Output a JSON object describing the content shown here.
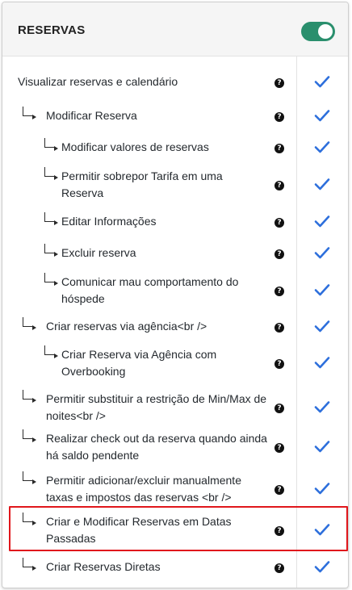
{
  "section": {
    "title": "RESERVAS",
    "toggle_on": true,
    "accent_color": "#2a8f6d",
    "check_color": "#2d6fdc",
    "highlight_color": "#e0161b"
  },
  "permissions": [
    {
      "label": "Visualizar reservas e calendário",
      "level": 0,
      "allowed": true
    },
    {
      "label": "Modificar Reserva",
      "level": 1,
      "allowed": true
    },
    {
      "label": "Modificar valores de reservas",
      "level": 2,
      "allowed": true
    },
    {
      "label": "Permitir sobrepor Tarifa em uma Reserva",
      "level": 2,
      "allowed": true
    },
    {
      "label": "Editar Informações",
      "level": 2,
      "allowed": true
    },
    {
      "label": "Excluir reserva",
      "level": 2,
      "allowed": true
    },
    {
      "label": "Comunicar mau comportamento do hóspede",
      "level": 2,
      "allowed": true
    },
    {
      "label": "Criar reservas via agência<br />",
      "level": 1,
      "allowed": true
    },
    {
      "label": "Criar Reserva via Agência com Overbooking",
      "level": 2,
      "allowed": true
    },
    {
      "label": "Permitir substituir a restrição de Min/Max de noites<br />",
      "level": 1,
      "allowed": true
    },
    {
      "label": "Realizar check out da reserva quando ainda há saldo pendente",
      "level": 1,
      "allowed": true
    },
    {
      "label": "Permitir adicionar/excluir manualmente taxas e impostos das reservas <br />",
      "level": 1,
      "allowed": true
    },
    {
      "label": "Criar e Modificar Reservas em Datas Passadas",
      "level": 1,
      "allowed": true,
      "highlighted": true
    },
    {
      "label": "Criar Reservas Diretas",
      "level": 1,
      "allowed": true
    }
  ],
  "icons": {
    "help": "question-circle-icon",
    "check": "check-icon",
    "child": "subdirectory-arrow-icon"
  },
  "help_glyph": "?"
}
